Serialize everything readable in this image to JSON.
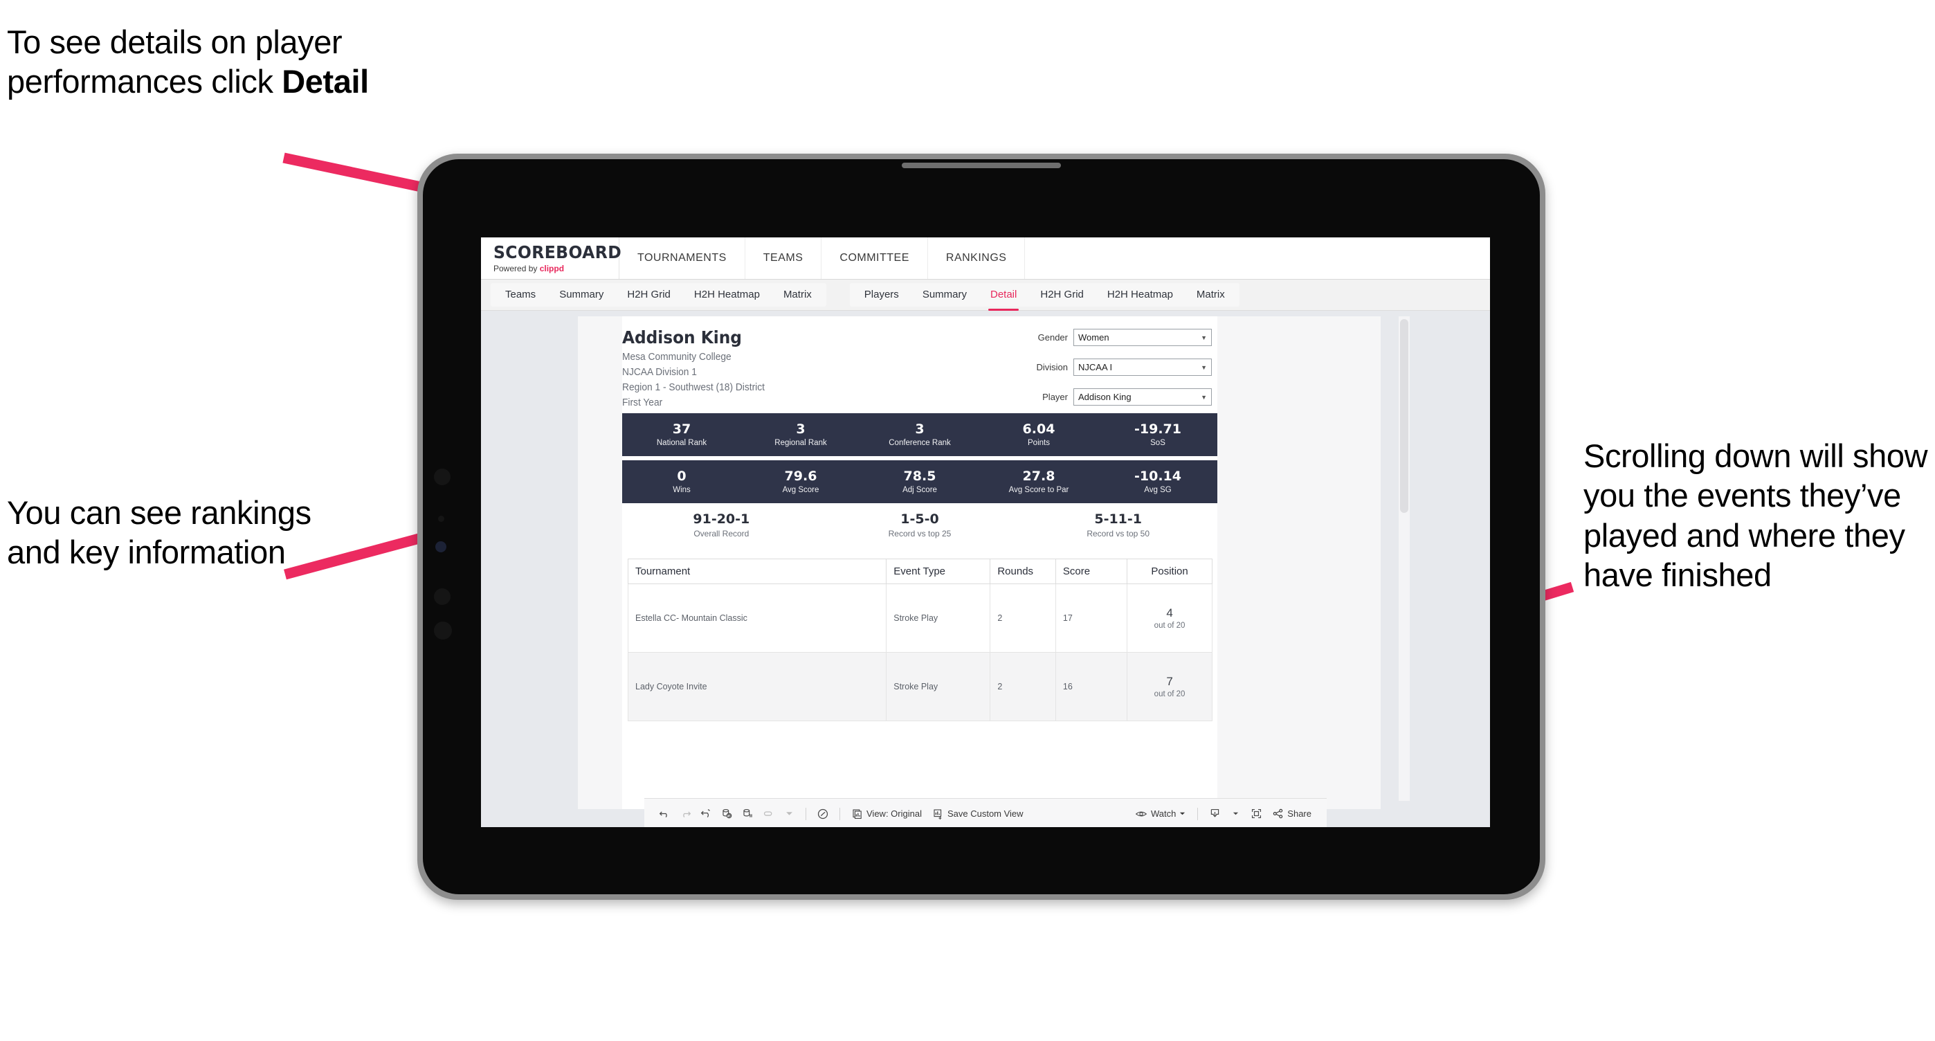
{
  "annotations": {
    "top_left": "To see details on player performances click ",
    "top_left_bold": "Detail",
    "left": "You can see rankings and key information",
    "right": "Scrolling down will show you the events they’ve played and where they have finished"
  },
  "colors": {
    "accent_pink": "#e8285c",
    "band_navy": "#2f3449",
    "arrow_pink": "#ec2a60",
    "screen_bg": "#e7e9ed"
  },
  "app": {
    "brand": {
      "title": "SCOREBOARD",
      "powered_prefix": "Powered by ",
      "powered_brand": "clippd"
    },
    "top_nav": [
      {
        "label": "TOURNAMENTS"
      },
      {
        "label": "TEAMS"
      },
      {
        "label": "COMMITTEE"
      },
      {
        "label": "RANKINGS"
      }
    ],
    "subnav_teams": {
      "group_label": "Teams",
      "items": [
        {
          "label": "Teams",
          "active": false
        },
        {
          "label": "Summary",
          "active": false
        },
        {
          "label": "H2H Grid",
          "active": false
        },
        {
          "label": "H2H Heatmap",
          "active": false
        },
        {
          "label": "Matrix",
          "active": false
        }
      ]
    },
    "subnav_players": {
      "items": [
        {
          "label": "Players",
          "active": false
        },
        {
          "label": "Summary",
          "active": false
        },
        {
          "label": "Detail",
          "active": true
        },
        {
          "label": "H2H Grid",
          "active": false
        },
        {
          "label": "H2H Heatmap",
          "active": false
        },
        {
          "label": "Matrix",
          "active": false
        }
      ]
    }
  },
  "player": {
    "name": "Addison King",
    "school": "Mesa Community College",
    "division": "NJCAA Division 1",
    "region": "Region 1 - Southwest (18) District",
    "year": "First Year"
  },
  "filters": [
    {
      "label": "Gender",
      "value": "Women"
    },
    {
      "label": "Division",
      "value": "NJCAA I"
    },
    {
      "label": "Player",
      "value": "Addison King"
    }
  ],
  "stats_row_1": [
    {
      "value": "37",
      "label": "National Rank"
    },
    {
      "value": "3",
      "label": "Regional Rank"
    },
    {
      "value": "3",
      "label": "Conference Rank"
    },
    {
      "value": "6.04",
      "label": "Points"
    },
    {
      "value": "-19.71",
      "label": "SoS"
    }
  ],
  "stats_row_2": [
    {
      "value": "0",
      "label": "Wins"
    },
    {
      "value": "79.6",
      "label": "Avg Score"
    },
    {
      "value": "78.5",
      "label": "Adj Score"
    },
    {
      "value": "27.8",
      "label": "Avg Score to Par"
    },
    {
      "value": "-10.14",
      "label": "Avg SG"
    }
  ],
  "records": [
    {
      "value": "91-20-1",
      "label": "Overall Record"
    },
    {
      "value": "1-5-0",
      "label": "Record vs top 25"
    },
    {
      "value": "5-11-1",
      "label": "Record vs top 50"
    }
  ],
  "tournaments": {
    "headers": [
      "Tournament",
      "Event Type",
      "Rounds",
      "Score",
      "Position"
    ],
    "rows": [
      {
        "tournament": "Estella CC- Mountain Classic",
        "event_type": "Stroke Play",
        "rounds": "2",
        "score": "17",
        "position": "4",
        "position_sub": "out of 20"
      },
      {
        "tournament": "Lady Coyote Invite",
        "event_type": "Stroke Play",
        "rounds": "2",
        "score": "16",
        "position": "7",
        "position_sub": "out of 20"
      }
    ]
  },
  "toolbar": {
    "view_label": "View: Original",
    "save_custom_view_label": "Save Custom View",
    "watch_label": "Watch",
    "share_label": "Share"
  }
}
